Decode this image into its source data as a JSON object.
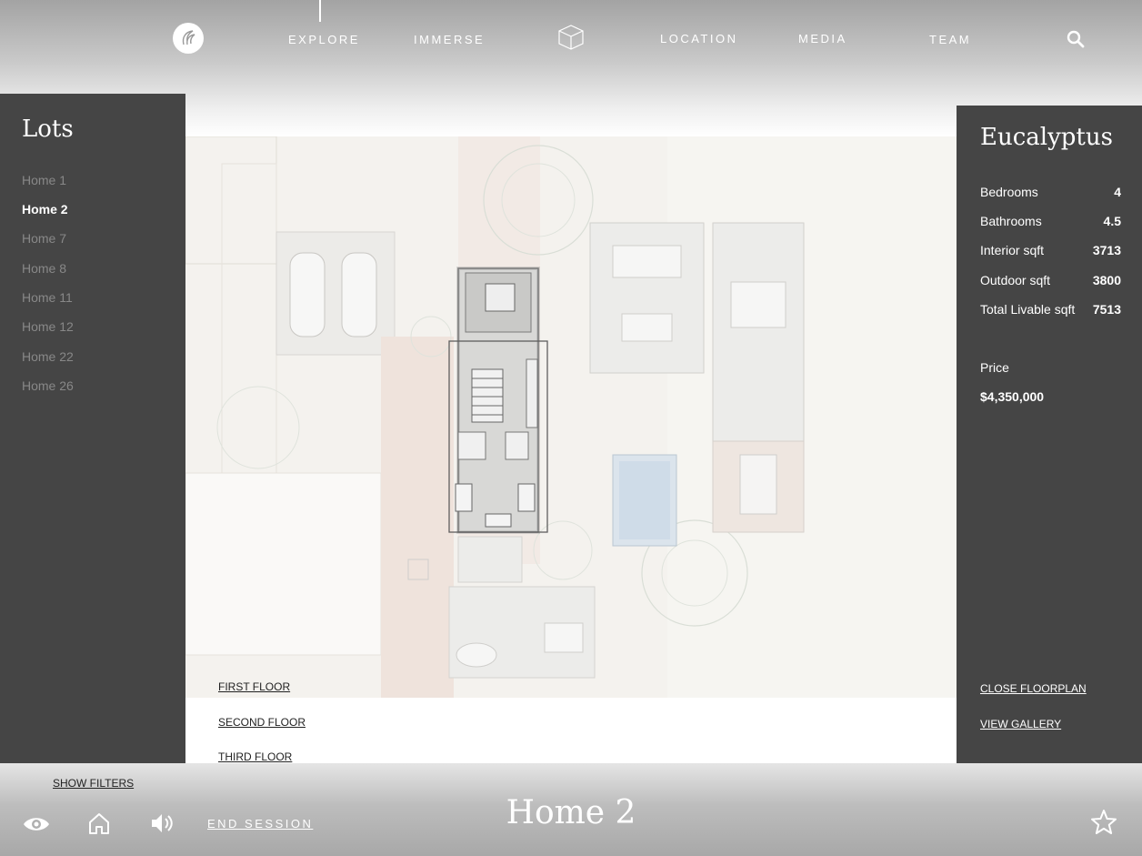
{
  "nav": {
    "items": [
      {
        "label": "EXPLORE"
      },
      {
        "label": "IMMERSE"
      },
      {
        "label": "LOCATION"
      },
      {
        "label": "MEDIA"
      },
      {
        "label": "TEAM"
      }
    ],
    "active": "EXPLORE"
  },
  "lots": {
    "title": "Lots",
    "items": [
      {
        "label": "Home 1"
      },
      {
        "label": "Home 2"
      },
      {
        "label": "Home 7"
      },
      {
        "label": "Home 8"
      },
      {
        "label": "Home 11"
      },
      {
        "label": "Home 12"
      },
      {
        "label": "Home 22"
      },
      {
        "label": "Home 26"
      }
    ],
    "selected": "Home 2"
  },
  "info": {
    "title": "Eucalyptus",
    "specs": [
      {
        "label": "Bedrooms",
        "value": "4"
      },
      {
        "label": "Bathrooms",
        "value": "4.5"
      },
      {
        "label": "Interior sqft",
        "value": "3713"
      },
      {
        "label": "Outdoor sqft",
        "value": "3800"
      },
      {
        "label": "Total Livable sqft",
        "value": "7513"
      }
    ],
    "price_label": "Price",
    "price_value": "$4,350,000",
    "close_floorplan": "CLOSE FLOORPLAN",
    "view_gallery": "VIEW GALLERY"
  },
  "floors": [
    {
      "label": "FIRST FLOOR"
    },
    {
      "label": "SECOND FLOOR"
    },
    {
      "label": "THIRD FLOOR"
    }
  ],
  "bottom": {
    "show_filters": "SHOW FILTERS",
    "end_session": "END SESSION",
    "home_title": "Home 2"
  },
  "icons": {
    "logo": "logo-icon",
    "cube": "cube-icon",
    "search": "search-icon",
    "eye": "eye-icon",
    "home": "home-icon",
    "volume": "volume-icon",
    "star": "star-icon"
  },
  "colors": {
    "panel": "#454545",
    "text_light": "#ffffff",
    "inactive_item": "#888888"
  }
}
